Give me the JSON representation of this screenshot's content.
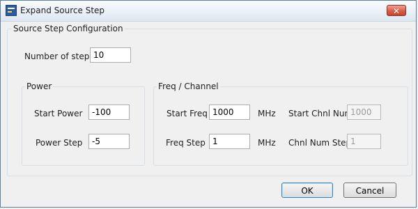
{
  "window": {
    "title": "Expand Source Step",
    "close_glyph": "✕"
  },
  "config": {
    "legend": "Source Step Configuration",
    "num_steps_label": "Number of steps",
    "num_steps_value": "10"
  },
  "power": {
    "legend": "Power",
    "start_label": "Start Power",
    "start_value": "-100",
    "step_label": "Power Step",
    "step_value": "-5"
  },
  "freq": {
    "legend": "Freq / Channel",
    "start_freq_label": "Start Freq",
    "start_freq_value": "1000",
    "start_freq_unit": "MHz",
    "freq_step_label": "Freq Step",
    "freq_step_value": "1",
    "freq_step_unit": "MHz",
    "start_chnl_label": "Start Chnl Num",
    "start_chnl_value": "1000",
    "chnl_step_label": "Chnl Num Step",
    "chnl_step_value": "1"
  },
  "buttons": {
    "ok": "OK",
    "cancel": "Cancel"
  }
}
